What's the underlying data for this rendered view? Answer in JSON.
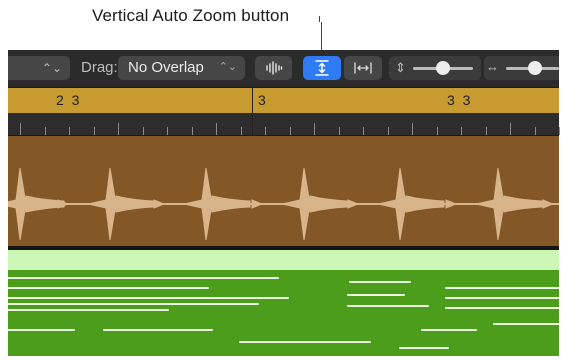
{
  "callout": {
    "label": "Vertical Auto Zoom button"
  },
  "toolbar": {
    "stepper_glyph": "⌃⌄",
    "drag_label": "Drag:",
    "drag_mode_value": "No Overlap",
    "select_arrow_glyph": "⌃⌄",
    "waveform_zoom_icon": "waveform-zoom-icon",
    "vertical_auto_zoom_icon": "vertical-auto-zoom-icon",
    "horizontal_auto_zoom_icon": "horizontal-auto-zoom-icon",
    "vertical_zoom_glyph": "⇕",
    "horizontal_zoom_glyph": "↔",
    "vertical_zoom_level": 0.5,
    "horizontal_zoom_level": 0.55,
    "active_color": "#2f7bf6"
  },
  "ruler": {
    "bar_numbers": [
      "2 3",
      "3",
      "3 3"
    ],
    "color": "#c79b2f"
  },
  "tracks": {
    "audio_region_color": "#845826",
    "midi_header_color": "#ccf7b6",
    "midi_region_color": "#4d9d1d"
  }
}
